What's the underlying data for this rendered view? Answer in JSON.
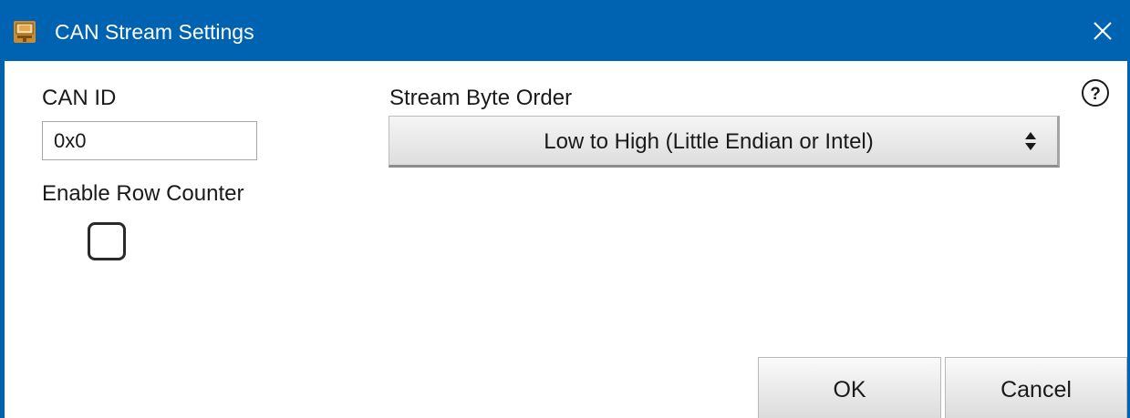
{
  "window": {
    "title": "CAN Stream Settings",
    "accent_color": "#0063b1",
    "icons": {
      "app": "app-icon",
      "close": "close-icon",
      "help": "help-icon",
      "select_arrows": "up-down-arrows-icon"
    }
  },
  "form": {
    "can_id": {
      "label": "CAN ID",
      "value": "0x0"
    },
    "row_counter": {
      "label": "Enable Row Counter",
      "checked": false
    },
    "byte_order": {
      "label": "Stream Byte Order",
      "selected": "Low to High (Little Endian or Intel)"
    }
  },
  "buttons": {
    "ok": "OK",
    "cancel": "Cancel"
  }
}
